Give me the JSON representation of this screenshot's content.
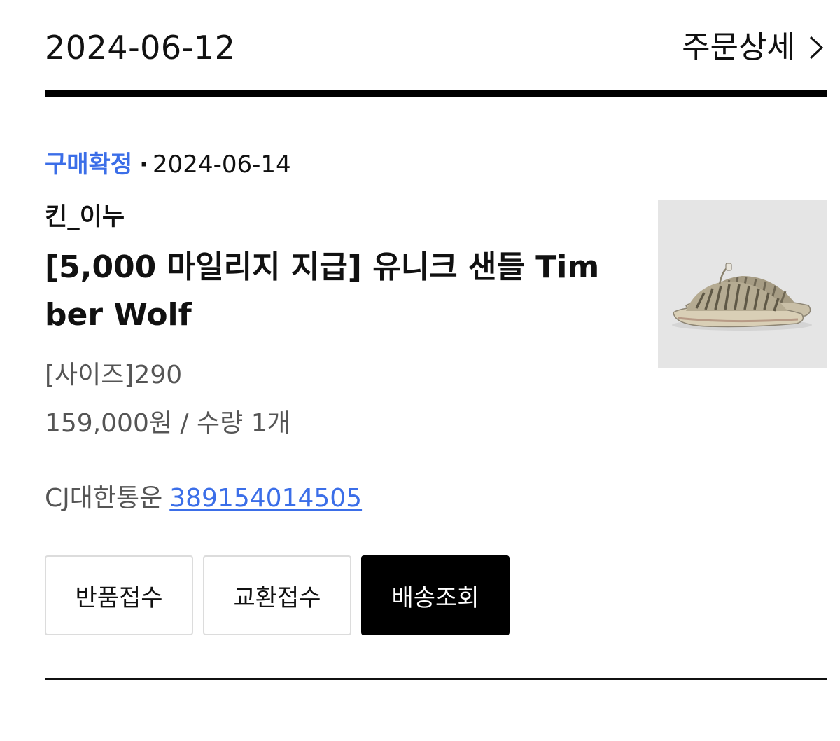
{
  "order": {
    "date": "2024-06-12",
    "detail_label": "주문상세"
  },
  "item": {
    "status_label": "구매확정",
    "status_separator": "·",
    "status_date": "2024-06-14",
    "seller": "킨_이누",
    "product_name": "[5,000 마일리지 지급] 유니크 샌들 Timber Wolf",
    "option": "[사이즈]290",
    "price_quantity": "159,000원 / 수량 1개",
    "image_alt": "sandal-product-image"
  },
  "shipping": {
    "carrier": "CJ대한통운",
    "tracking_number": "389154014505"
  },
  "actions": {
    "return_label": "반품접수",
    "exchange_label": "교환접수",
    "track_label": "배송조회"
  },
  "icons": {
    "detail": "chevron-right-icon"
  },
  "colors": {
    "accent_blue": "#3b6ee8",
    "primary_button_bg": "#000000",
    "image_bg": "#e5e5e5"
  }
}
